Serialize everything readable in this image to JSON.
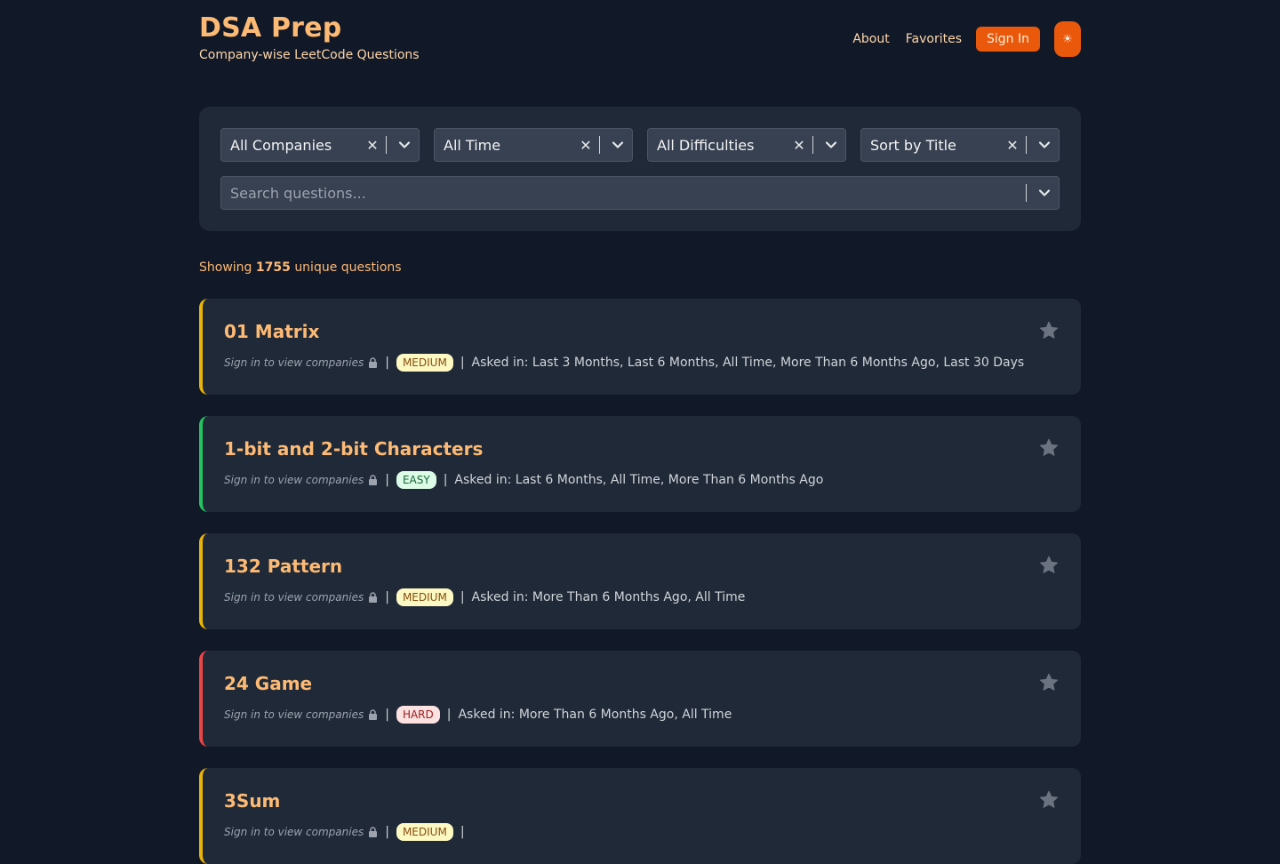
{
  "brand": {
    "title": "DSA Prep",
    "subtitle": "Company-wise LeetCode Questions"
  },
  "nav": {
    "about": "About",
    "favorites": "Favorites",
    "signin": "Sign In",
    "theme_icon": "☀"
  },
  "filters": {
    "company": "All Companies",
    "time": "All Time",
    "difficulty": "All Difficulties",
    "sort": "Sort by Title",
    "clear_glyph": "✕",
    "search_placeholder": "Search questions..."
  },
  "summary": {
    "prefix": "Showing",
    "count": "1755",
    "suffix": "unique questions"
  },
  "questions": [
    {
      "title": "01 Matrix",
      "signin_note": "Sign in to view companies",
      "difficulty": "MEDIUM",
      "asked_in": "Asked in: Last 3 Months, Last 6 Months, All Time, More Than 6 Months Ago, Last 30 Days"
    },
    {
      "title": "1-bit and 2-bit Characters",
      "signin_note": "Sign in to view companies",
      "difficulty": "EASY",
      "asked_in": "Asked in: Last 6 Months, All Time, More Than 6 Months Ago"
    },
    {
      "title": "132 Pattern",
      "signin_note": "Sign in to view companies",
      "difficulty": "MEDIUM",
      "asked_in": "Asked in: More Than 6 Months Ago, All Time"
    },
    {
      "title": "24 Game",
      "signin_note": "Sign in to view companies",
      "difficulty": "HARD",
      "asked_in": "Asked in: More Than 6 Months Ago, All Time"
    },
    {
      "title": "3Sum",
      "signin_note": "Sign in to view companies",
      "difficulty": "MEDIUM",
      "asked_in": ""
    }
  ],
  "colors": {
    "background": "#111827",
    "panel": "#1f2937",
    "accent": "#ea580c",
    "title": "#fdba74",
    "medium": "#eab308",
    "easy": "#22c55e",
    "hard": "#ef4444"
  }
}
